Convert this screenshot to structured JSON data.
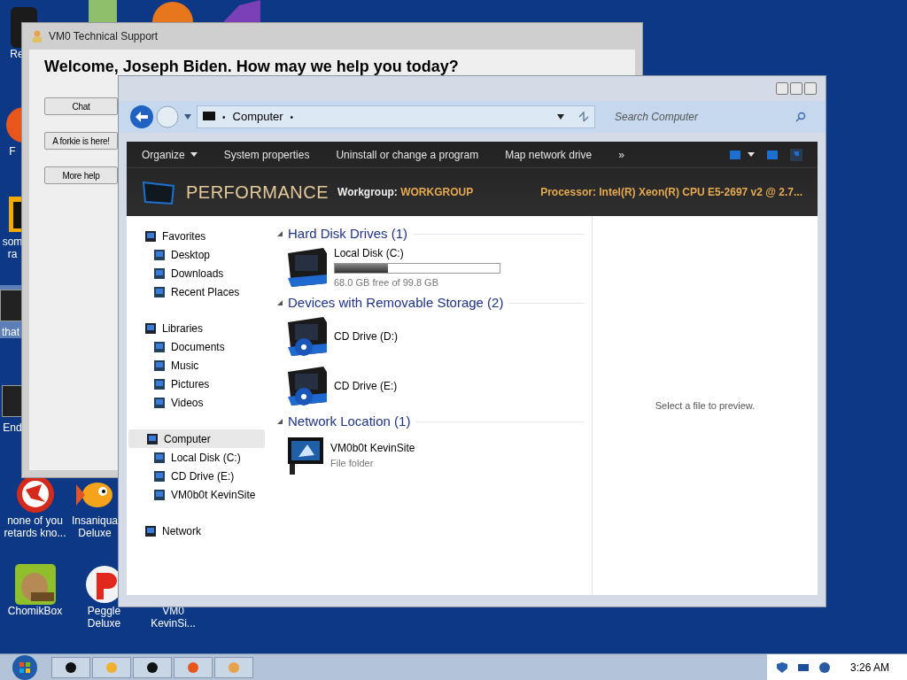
{
  "desktop_icons": [
    {
      "label": "Re",
      "kind": "bin"
    },
    {
      "label": "F",
      "kind": "orb"
    },
    {
      "label": "som ra",
      "kind": "folder"
    },
    {
      "label": "that",
      "kind": "dark",
      "selected": true
    },
    {
      "label": "End",
      "kind": "dark",
      "selected": false
    },
    {
      "label": "none of you retards kno...",
      "kind": "red"
    },
    {
      "label": "Insaniqua Deluxe",
      "kind": "fish"
    },
    {
      "label": "ChomikBox",
      "kind": "green"
    },
    {
      "label": "Peggle Deluxe",
      "kind": "peggle"
    },
    {
      "label": "VM0 KevinSi...",
      "kind": "blank"
    }
  ],
  "support_window": {
    "title": "VM0 Technical Support",
    "heading": "Welcome, Joseph Biden. How may we help you today?",
    "buttons": [
      "Chat",
      "A forkie is here!",
      "More help"
    ]
  },
  "explorer": {
    "address": {
      "lead": "•",
      "location": "Computer",
      "trail": "•"
    },
    "search_placeholder": "Search Computer",
    "toolbar": [
      {
        "label": "Organize",
        "dropdown": true
      },
      {
        "label": "System properties",
        "dropdown": false
      },
      {
        "label": "Uninstall or change a program",
        "dropdown": false
      },
      {
        "label": "Map network drive",
        "dropdown": false
      },
      {
        "label": "»",
        "dropdown": false
      }
    ],
    "banner": {
      "title": "PERFORMANCE",
      "workgroup_label": "Workgroup:",
      "workgroup": "WORKGROUP",
      "processor_label": "Processor:",
      "processor": "Intel(R) Xeon(R) CPU E5-2697 v2 @ 2.7..."
    },
    "nav": [
      {
        "label": "Favorites",
        "selected": false,
        "children": [
          {
            "label": "Desktop"
          },
          {
            "label": "Downloads"
          },
          {
            "label": "Recent Places"
          }
        ]
      },
      {
        "label": "Libraries",
        "selected": false,
        "children": [
          {
            "label": "Documents"
          },
          {
            "label": "Music"
          },
          {
            "label": "Pictures"
          },
          {
            "label": "Videos"
          }
        ]
      },
      {
        "label": "Computer",
        "selected": true,
        "children": [
          {
            "label": "Local Disk (C:)"
          },
          {
            "label": "CD Drive (E:)"
          },
          {
            "label": "VM0b0t KevinSite"
          }
        ]
      },
      {
        "label": "Network",
        "selected": false
      }
    ],
    "sections": [
      {
        "title": "Hard Disk Drives (1)",
        "items": [
          {
            "kind": "disk",
            "name": "Local Disk (C:)",
            "level": 0.32,
            "detail": "68.0 GB free of 99.8 GB"
          }
        ]
      },
      {
        "title": "Devices with Removable Storage (2)",
        "items": [
          {
            "kind": "cd",
            "name": "CD Drive (D:)"
          },
          {
            "kind": "cd",
            "name": "CD Drive (E:)"
          }
        ]
      },
      {
        "title": "Network Location (1)",
        "items": [
          {
            "kind": "network",
            "name": "VM0b0t KevinSite",
            "detail": "File folder"
          }
        ]
      }
    ],
    "preview_text": "Select a file to preview."
  },
  "taskbar": {
    "clock": "3:26 AM"
  }
}
